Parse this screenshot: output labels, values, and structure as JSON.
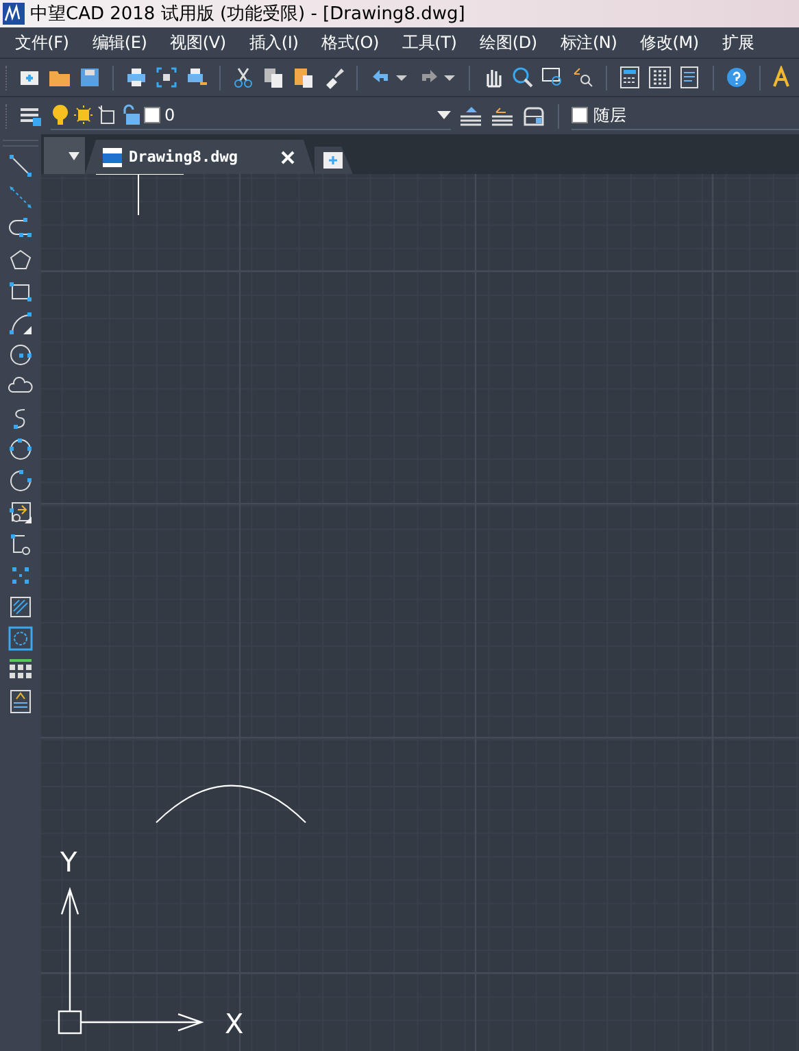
{
  "window": {
    "title": "中望CAD 2018 试用版 (功能受限) - [Drawing8.dwg]"
  },
  "menu": [
    "文件(F)",
    "编辑(E)",
    "视图(V)",
    "插入(I)",
    "格式(O)",
    "工具(T)",
    "绘图(D)",
    "标注(N)",
    "修改(M)",
    "扩展"
  ],
  "layer_toolbar": {
    "layer_name": "0",
    "linetype": "随层"
  },
  "tabs": [
    {
      "label": "Drawing8.dwg",
      "selected": true
    }
  ],
  "ucs": {
    "x_label": "X",
    "y_label": "Y"
  }
}
